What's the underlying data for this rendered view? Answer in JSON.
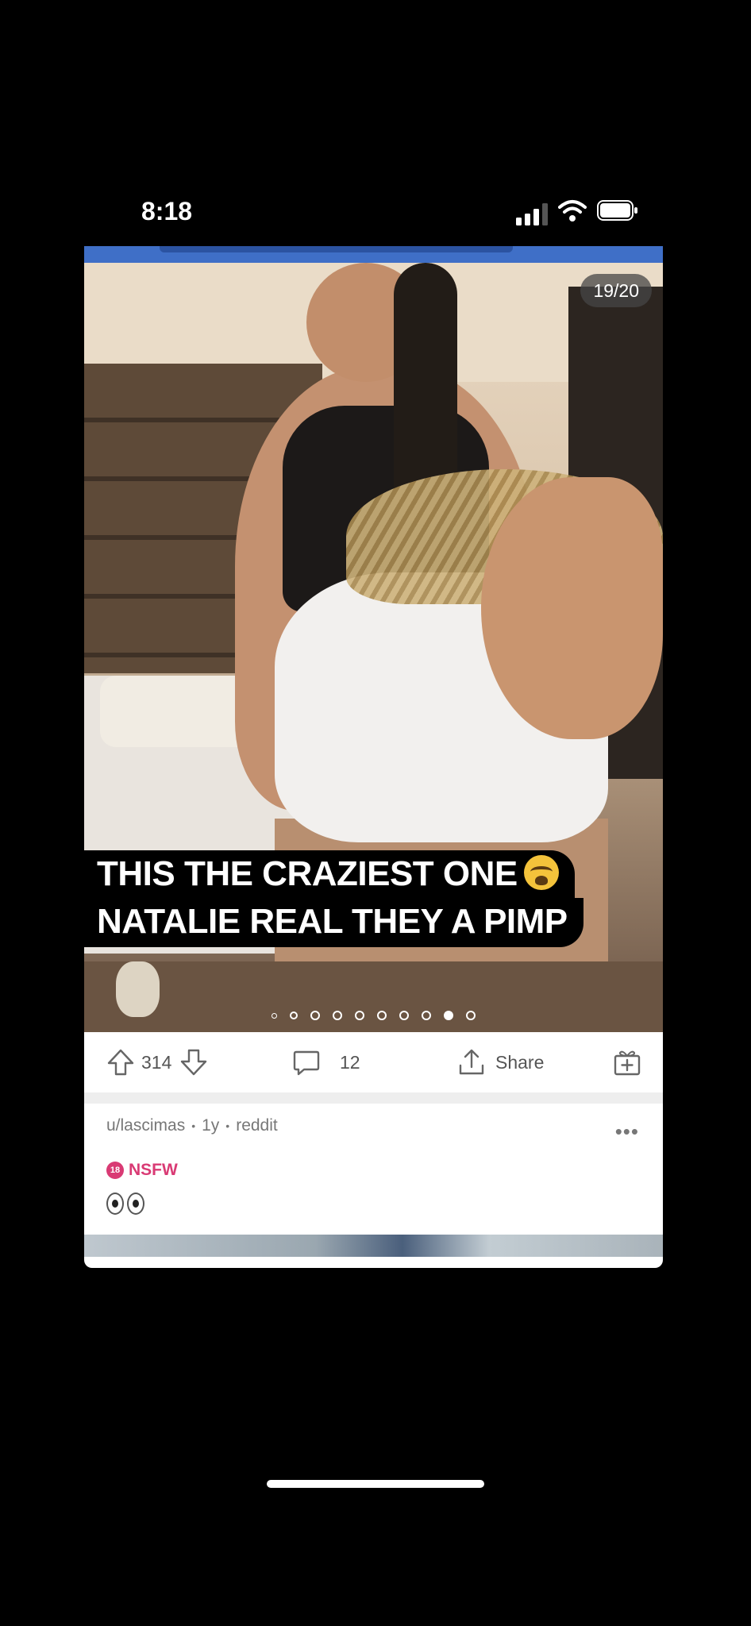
{
  "status_bar": {
    "time": "8:18",
    "signal_icon": "cellular-signal-icon",
    "wifi_icon": "wifi-icon",
    "battery_icon": "battery-icon"
  },
  "post": {
    "image_counter": "19/20",
    "caption_line1": "THIS THE CRAZIEST ONE",
    "caption_emoji": "loudly-crying-face-emoji",
    "caption_line2": "NATALIE REAL THEY A PIMP",
    "gallery": {
      "total_dots": 10,
      "active_index": 8
    },
    "actions": {
      "upvote_count": "314",
      "comment_count": "12",
      "share_label": "Share"
    },
    "meta": {
      "author": "u/lascimas",
      "age": "1y",
      "source": "reddit",
      "separator": "•",
      "more": "•••"
    },
    "nsfw_badge": "18",
    "nsfw_label": "NSFW",
    "body_emoji": "eyes-emoji"
  },
  "colors": {
    "accent_blue": "#3f6fc7",
    "nsfw_pink": "#d93a74"
  }
}
